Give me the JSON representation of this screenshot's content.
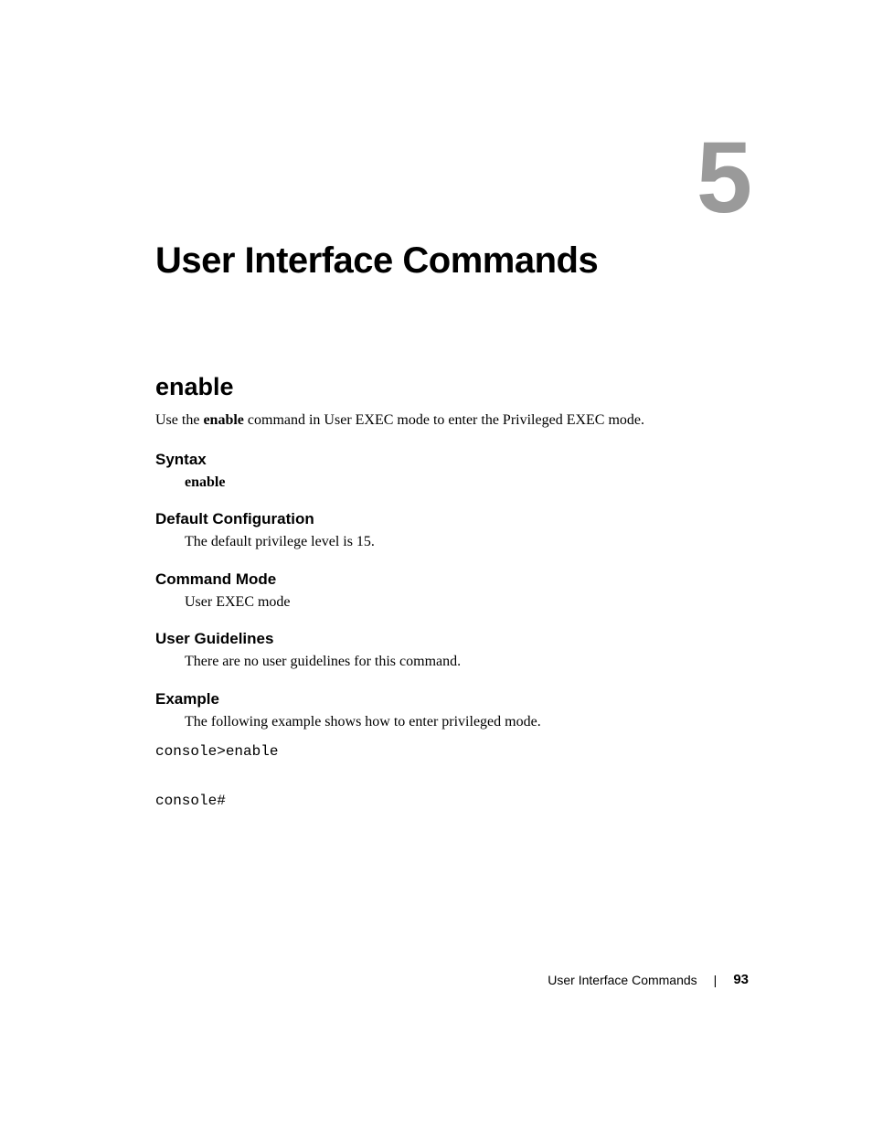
{
  "chapter": {
    "number": "5",
    "title": "User Interface Commands"
  },
  "section": {
    "title": "enable",
    "intro_prefix": "Use the ",
    "intro_bold": "enable",
    "intro_suffix": " command in User EXEC mode to enter the Privileged EXEC mode."
  },
  "syntax": {
    "heading": "Syntax",
    "text": "enable"
  },
  "default_config": {
    "heading": "Default Configuration",
    "text": "The default privilege level is 15."
  },
  "command_mode": {
    "heading": "Command Mode",
    "text": "User EXEC mode"
  },
  "user_guidelines": {
    "heading": "User Guidelines",
    "text": "There are no user guidelines for this command."
  },
  "example": {
    "heading": "Example",
    "text": "The following example shows how to enter privileged mode.",
    "code": "console>enable\n\nconsole#"
  },
  "footer": {
    "section": "User Interface Commands",
    "page": "93"
  }
}
